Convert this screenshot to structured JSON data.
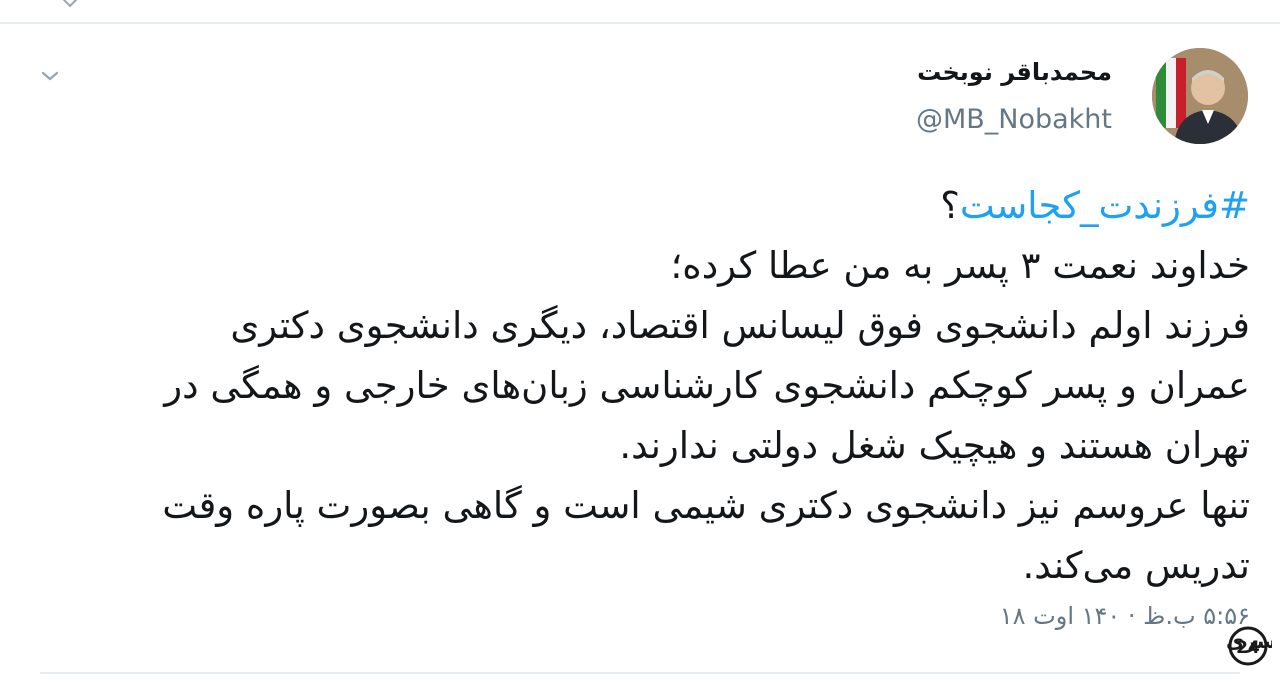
{
  "tweet": {
    "author": {
      "display_name": "محمدباقر نوبخت",
      "handle": "@MB_Nobakht",
      "avatar_icon": "user-avatar"
    },
    "hashtag": "#فرزندت_کجاست",
    "hashtag_suffix": "؟",
    "lines": [
      "خداوند نعمت ۳ پسر به من عطا کرده؛",
      "فرزند اولم دانشجوی فوق لیسانس اقتصاد، دیگری دانشجوی دکتری",
      "عمران و پسر کوچکم دانشجوی کارشناسی زبان‌های خارجی و همگی در",
      "تهران هستند و هیچیک شغل دولتی ندارند.",
      "تنها عروسم نیز دانشجوی دکتری شیمی است و گاهی بصورت پاره وقت",
      "تدریس می‌کند."
    ],
    "timestamp": "۵:۵۶ ب.ظ · ۱۴۰ اوت ۱۸"
  },
  "watermark": {
    "text": "سراسری",
    "number": "24"
  },
  "colors": {
    "link": "#1da1f2",
    "secondary_text": "#657786",
    "divider": "#e6ecf0"
  }
}
